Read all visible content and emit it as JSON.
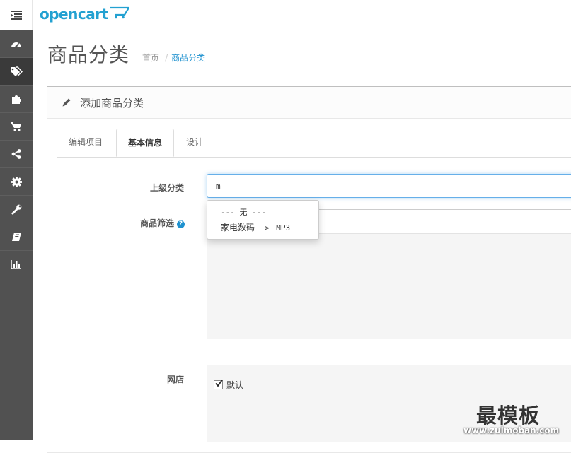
{
  "header": {
    "logo_text": "opencart"
  },
  "sidebar": {
    "items": [
      {
        "icon": "dashboard-icon"
      },
      {
        "icon": "tag-icon",
        "active": true
      },
      {
        "icon": "puzzle-icon"
      },
      {
        "icon": "shopping-cart-icon"
      },
      {
        "icon": "share-icon"
      },
      {
        "icon": "gear-icon"
      },
      {
        "icon": "wrench-icon"
      },
      {
        "icon": "book-icon"
      },
      {
        "icon": "bar-chart-icon"
      }
    ]
  },
  "page": {
    "title": "商品分类",
    "breadcrumb": {
      "home": "首页",
      "sep": "/",
      "current": "商品分类"
    }
  },
  "panel": {
    "title": "添加商品分类"
  },
  "tabs": [
    "编辑项目",
    "基本信息",
    "设计"
  ],
  "form": {
    "parent_label": "上级分类",
    "parent_value": "m",
    "filter_label": "商品筛选",
    "help_glyph": "?",
    "store_label": "网店",
    "store_default_label": "默认",
    "store_default_checked": true
  },
  "autocomplete": {
    "item_none": "--- 无 ---",
    "item_cat_main": "家电数码",
    "item_cat_arrow": ">",
    "item_cat_sub": "MP3"
  },
  "watermark": {
    "title": "最模板",
    "url": "www.zuimoban.com"
  },
  "colors": {
    "accent": "#1e91cf",
    "logo": "#23a1d1",
    "sidebar": "#515151"
  }
}
